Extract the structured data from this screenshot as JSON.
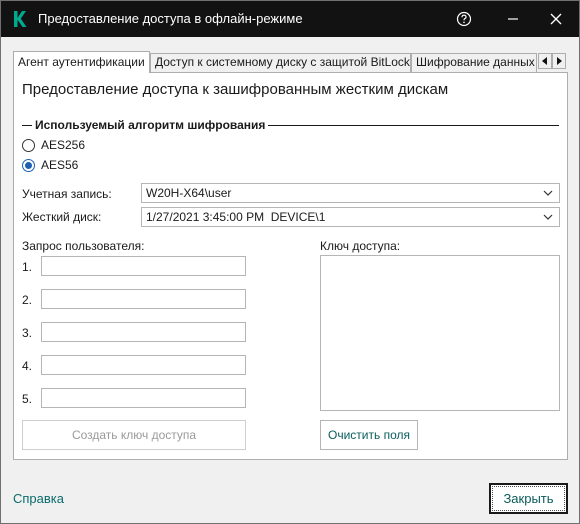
{
  "window": {
    "title": "Предоставление доступа в офлайн-режиме"
  },
  "tabs": [
    {
      "label": "Агент аутентификации",
      "active": true
    },
    {
      "label": "Доступ к системному диску с защитой BitLocker",
      "active": false
    },
    {
      "label": "Шифрование данных",
      "active": false
    }
  ],
  "panel": {
    "heading": "Предоставление доступа к зашифрованным жестким дискам",
    "algorithm_group": {
      "title": "Используемый алгоритм шифрования",
      "options": [
        {
          "label": "AES256",
          "checked": false
        },
        {
          "label": "AES56",
          "checked": true
        }
      ]
    },
    "account": {
      "label": "Учетная запись:",
      "value": "W20H-X64\\user"
    },
    "disk": {
      "label": "Жесткий диск:",
      "value": "1/27/2021 3:45:00 PM  DEVICE\\1"
    },
    "user_request": {
      "label": "Запрос пользователя:",
      "numbers": [
        "1.",
        "2.",
        "3.",
        "4.",
        "5."
      ]
    },
    "access_key": {
      "label": "Ключ доступа:"
    },
    "create_key_button": "Создать ключ доступа",
    "clear_fields_button": "Очистить поля"
  },
  "footer": {
    "help_link": "Справка",
    "close_button": "Закрыть"
  },
  "colors": {
    "titlebar": "#121212",
    "accent_blue": "#1c5fb3",
    "teal_link": "#0a6b6b",
    "logo_green": "#00a88e"
  }
}
